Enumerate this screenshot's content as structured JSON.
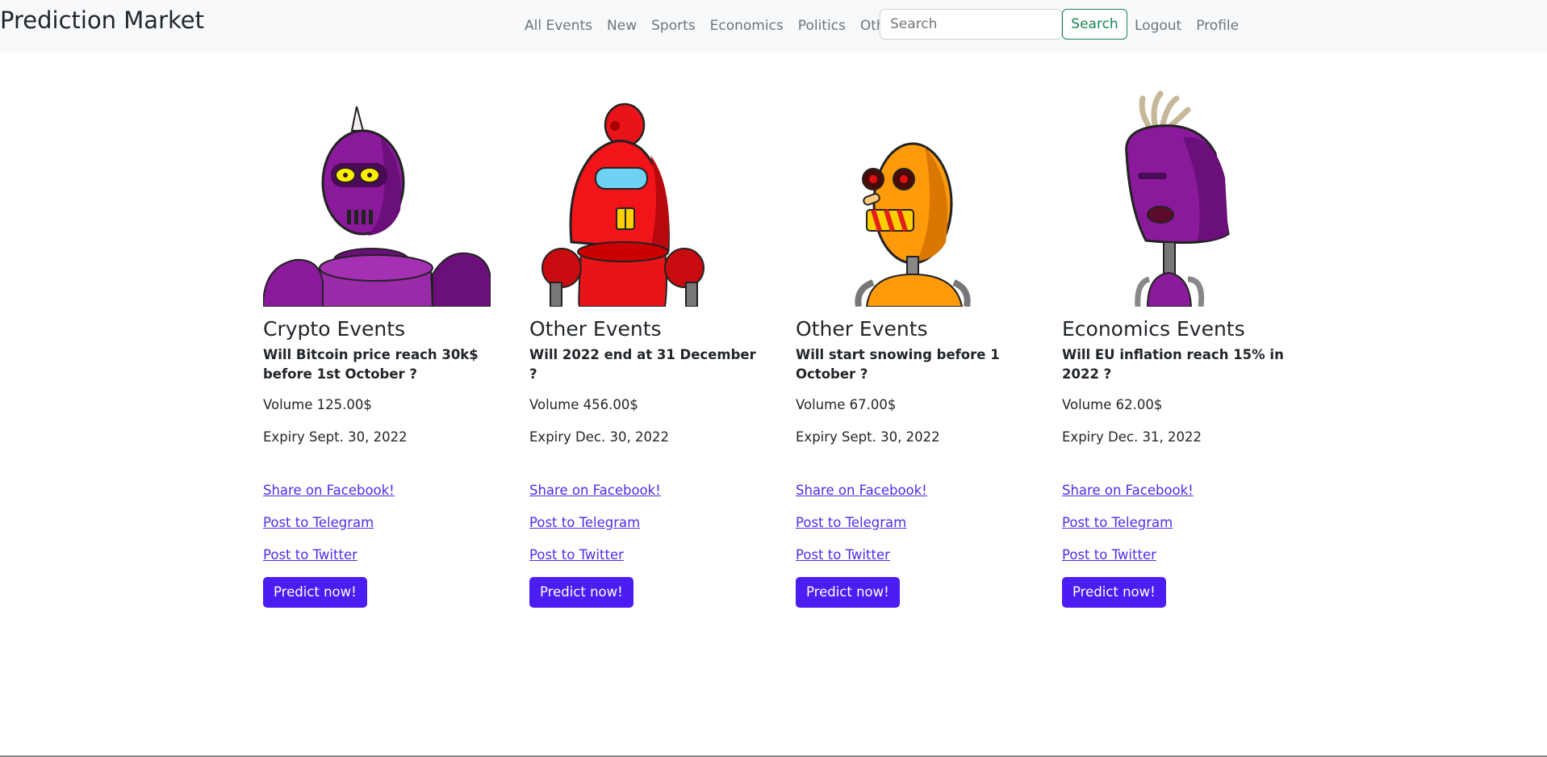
{
  "navbar": {
    "brand": "Prediction Market",
    "links": [
      "All Events",
      "New",
      "Sports",
      "Economics",
      "Politics",
      "Other"
    ],
    "search_placeholder": "Search",
    "search_button": "Search",
    "right_links": [
      "Logout",
      "Profile"
    ]
  },
  "cards": [
    {
      "category": "Crypto Events",
      "question": "Will Bitcoin price reach 30k$ before 1st October ?",
      "volume": "Volume 125.00$",
      "expiry": "Expiry Sept. 30, 2022",
      "share_facebook": "Share on Facebook!",
      "post_telegram": "Post to Telegram",
      "post_twitter": "Post to Twitter",
      "button": "Predict now!"
    },
    {
      "category": "Other Events",
      "question": "Will 2022 end at 31 December ?",
      "volume": "Volume 456.00$",
      "expiry": "Expiry Dec. 30, 2022",
      "share_facebook": "Share on Facebook!",
      "post_telegram": "Post to Telegram",
      "post_twitter": "Post to Twitter",
      "button": "Predict now!"
    },
    {
      "category": "Other Events",
      "question": "Will start snowing before 1 October ?",
      "volume": "Volume 67.00$",
      "expiry": "Expiry Sept. 30, 2022",
      "share_facebook": "Share on Facebook!",
      "post_telegram": "Post to Telegram",
      "post_twitter": "Post to Twitter",
      "button": "Predict now!"
    },
    {
      "category": "Economics Events",
      "question": "Will EU inflation reach 15% in 2022 ?",
      "volume": "Volume 62.00$",
      "expiry": "Expiry Dec. 31, 2022",
      "share_facebook": "Share on Facebook!",
      "post_telegram": "Post to Telegram",
      "post_twitter": "Post to Twitter",
      "button": "Predict now!"
    }
  ],
  "colors": {
    "navbar_bg": "#f8f9fa",
    "link": "#4c2ee6",
    "button": "#4b1df2",
    "search_green": "#198754"
  },
  "images": [
    "purple-robot-antenna",
    "red-robot",
    "orange-robot",
    "purple-robot-hair"
  ]
}
